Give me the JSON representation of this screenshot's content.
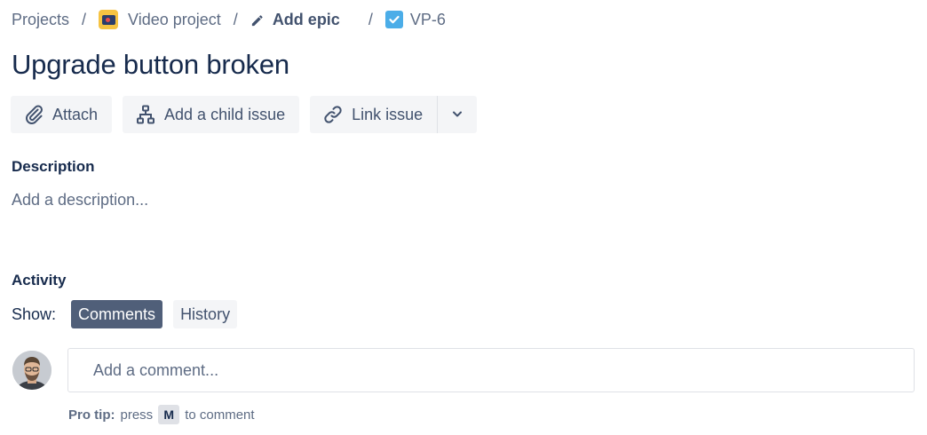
{
  "breadcrumb": {
    "projects": "Projects",
    "project_name": "Video project",
    "add_epic": "Add epic",
    "issue_key": "VP-6",
    "separator": "/"
  },
  "issue": {
    "title": "Upgrade button broken"
  },
  "toolbar": {
    "attach": "Attach",
    "add_child": "Add a child issue",
    "link_issue": "Link issue"
  },
  "description": {
    "heading": "Description",
    "placeholder": "Add a description..."
  },
  "activity": {
    "heading": "Activity",
    "show_label": "Show:",
    "filters": [
      "Comments",
      "History"
    ],
    "active_filter": "Comments"
  },
  "comment": {
    "placeholder": "Add a comment...",
    "protip_label": "Pro tip:",
    "protip_pre": "press",
    "protip_key": "M",
    "protip_post": "to comment"
  },
  "colors": {
    "text_primary": "#172b4d",
    "text_subtle": "#5e6c84",
    "button_bg": "#f4f5f7",
    "chip_active_bg": "#505f79",
    "issue_type": "#4bade8",
    "project_icon": "#f6c342"
  },
  "icons": {
    "project": "video-project-icon",
    "add_epic": "pencil-icon",
    "issue_type": "task-checkbox-icon",
    "attach": "paperclip-icon",
    "child": "hierarchy-icon",
    "link": "link-icon",
    "more": "chevron-down-icon"
  }
}
